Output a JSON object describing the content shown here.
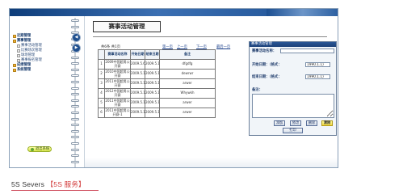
{
  "sidebar": {
    "items": [
      {
        "label": "近期管理",
        "icon": "folder-icon",
        "level": "top"
      },
      {
        "label": "赛事管理",
        "icon": "folder-icon",
        "level": "top"
      },
      {
        "label": "赛事活动管理",
        "icon": "page-icon",
        "level": "sub"
      },
      {
        "label": "比赛场次管理",
        "icon": "page-icon",
        "level": "sub"
      },
      {
        "label": "球场管理",
        "icon": "page-icon",
        "level": "sub"
      },
      {
        "label": "赛事报名管理",
        "icon": "page-icon",
        "level": "sub"
      },
      {
        "label": "成绩管理",
        "icon": "folder-icon",
        "level": "top"
      },
      {
        "label": "系统管理",
        "icon": "folder-icon",
        "level": "top"
      }
    ],
    "exit_label": "退出系统"
  },
  "page": {
    "title": "赛事活动管理"
  },
  "pager": {
    "info": "共6条 共1页",
    "first": "第一页",
    "prev": "上一页",
    "next": "下一页",
    "last": "最后一页"
  },
  "table": {
    "headers": [
      "",
      "赛事活动名称",
      "开始日期",
      "结束日期",
      "备注"
    ],
    "rows": [
      [
        "1",
        "2009中国超男公开赛",
        "2009.5.6",
        "2009.5.10",
        "dfgdfg"
      ],
      [
        "2",
        "2010中国超男公开赛",
        "2009.5.11",
        "2009.5.15",
        "dewrwr"
      ],
      [
        "3",
        "2011中国超男公开赛",
        "2009.5.14",
        "2009.5.16",
        "arwer"
      ],
      [
        "4",
        "2012中国超男公开赛",
        "2009.5.15",
        "2009.5.16",
        "Whywkh"
      ],
      [
        "5",
        "2011中国超男公开赛",
        "2009.5.14",
        "2009.5.16",
        "arwer"
      ],
      [
        "6",
        "2011中国超男公开赛-1",
        "2009.5.14",
        "2009.5.16",
        "arwer"
      ]
    ]
  },
  "form": {
    "title": "赛事活动管理",
    "name_label": "赛事活动名称：",
    "name_value": "",
    "start_label": "开始日期：（格式：",
    "start_value": "1990.1.1)",
    "end_label": "结束日期：（格式：",
    "end_value": "1990.1.1)",
    "remark_label": "备注：",
    "add_label": "添加",
    "edit_label": "修改",
    "delete_label": "删除",
    "clear_label": "清除",
    "print_label": "打印"
  },
  "caption": {
    "prefix": "5S Severs",
    "open": "【",
    "accent": "5S 服务",
    "close": "】"
  },
  "colors": {
    "header_blue": "#1c4079",
    "accent_red": "#d23b3b",
    "exit_button": "#d8e84c"
  }
}
